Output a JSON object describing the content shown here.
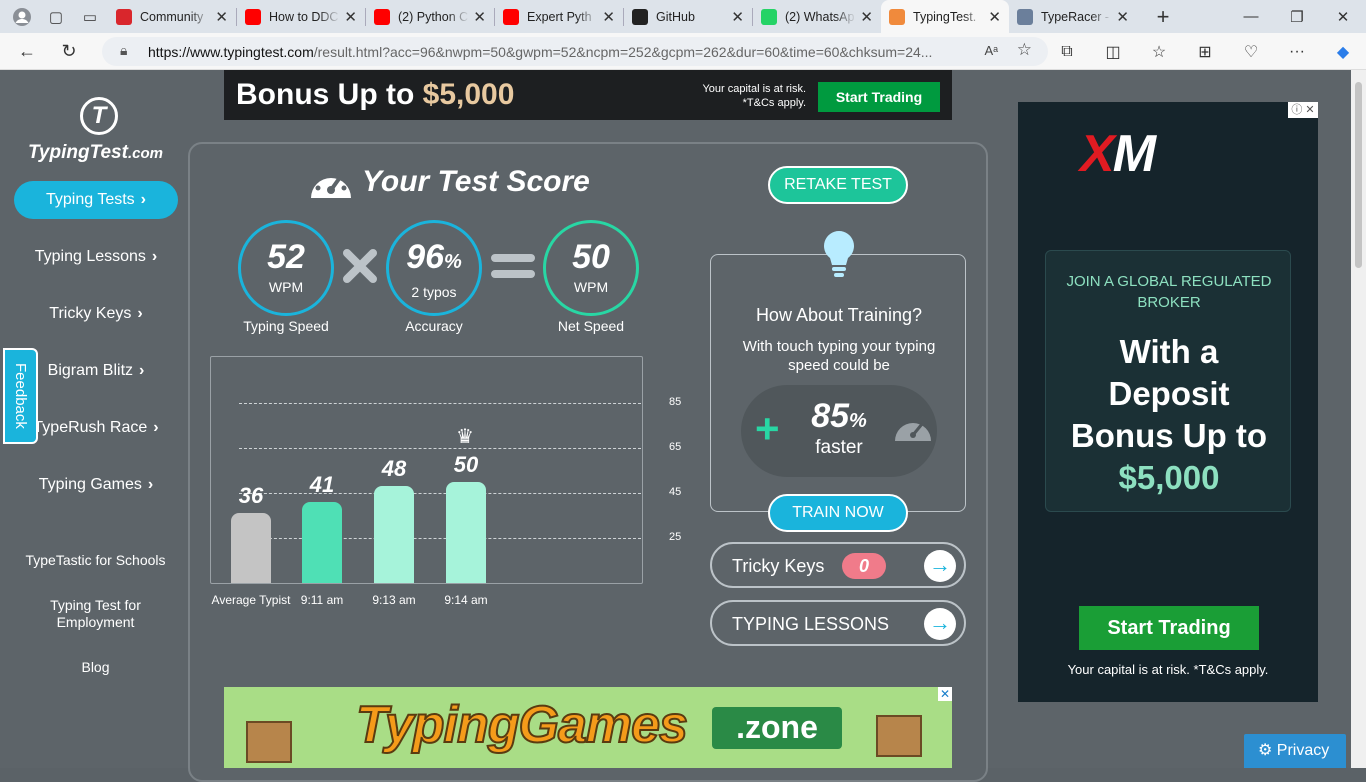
{
  "browser": {
    "tabs": [
      {
        "title": "Community",
        "favicon": "pdf-icon",
        "color": "#d9262c"
      },
      {
        "title": "How to DDC",
        "favicon": "youtube-icon",
        "color": "#ff0000"
      },
      {
        "title": "(2) Python C",
        "favicon": "youtube-icon",
        "color": "#ff0000"
      },
      {
        "title": "Expert Pyth",
        "favicon": "youtube-icon",
        "color": "#ff0000"
      },
      {
        "title": "GitHub",
        "favicon": "github-icon",
        "color": "#222222"
      },
      {
        "title": "(2) WhatsAp",
        "favicon": "whatsapp-icon",
        "color": "#25d366"
      },
      {
        "title": "TypingTest.",
        "favicon": "typingtest-icon",
        "color": "#f08a3c"
      },
      {
        "title": "TypeRacer -",
        "favicon": "typeracer-icon",
        "color": "#6b7f9b"
      }
    ],
    "url_host": "https://www.typingtest.com",
    "url_rest": "/result.html?acc=96&nwpm=50&gwpm=52&ncpm=252&gcpm=262&dur=60&time=60&chksum=24..."
  },
  "sidebar": {
    "logo_main": "TypingTest",
    "logo_suffix": ".com",
    "items": [
      {
        "label": "Typing Tests"
      },
      {
        "label": "Typing Lessons"
      },
      {
        "label": "Tricky Keys"
      },
      {
        "label": "Bigram Blitz"
      },
      {
        "label": "TypeRush Race"
      },
      {
        "label": "Typing Games"
      }
    ],
    "links": [
      "TypeTastic for Schools",
      "Typing Test for Employment",
      "Blog"
    ],
    "feedback": "Feedback"
  },
  "top_ad": {
    "headline": "Bonus Up to ",
    "amount": "$5,000",
    "risk": "Your capital is at risk. *T&Cs apply.",
    "cta": "Start Trading"
  },
  "score": {
    "title": "Your Test Score",
    "retake": "RETAKE TEST",
    "typing_speed": {
      "value": "52",
      "unit": "WPM",
      "label": "Typing Speed"
    },
    "accuracy": {
      "value": "96",
      "suffix": "%",
      "sub": "2 typos",
      "label": "Accuracy"
    },
    "net_speed": {
      "value": "50",
      "unit": "WPM",
      "label": "Net Speed"
    }
  },
  "chart_data": {
    "type": "bar",
    "categories": [
      "Average Typist",
      "9:11 am",
      "9:13 am",
      "9:14 am"
    ],
    "values": [
      36,
      41,
      48,
      50
    ],
    "yticks": [
      25,
      45,
      65,
      85
    ],
    "ylim": [
      5,
      85
    ],
    "colors": [
      "#c4c4c4",
      "#4fe0b5",
      "#a6f3da",
      "#a6f3da"
    ]
  },
  "training": {
    "heading": "How About Training?",
    "text": "With touch typing your typing speed could be",
    "percent": "85",
    "percent_suffix": "%",
    "faster": "faster",
    "cta": "TRAIN NOW"
  },
  "pills": {
    "tricky_keys": "Tricky Keys",
    "tricky_count": "0",
    "lessons": "TYPING LESSONS"
  },
  "bottom_ad": {
    "brand": "TypingGames",
    "zone": ".zone"
  },
  "right_ad": {
    "brand_x": "X",
    "brand_m": "M",
    "join": "JOIN A GLOBAL REGULATED BROKER",
    "line1": "With a",
    "line2": "Deposit",
    "line3": "Bonus Up to",
    "amount": "$5,000",
    "cta": "Start Trading",
    "risk": "Your capital is at risk. *T&Cs apply."
  },
  "privacy": "Privacy"
}
